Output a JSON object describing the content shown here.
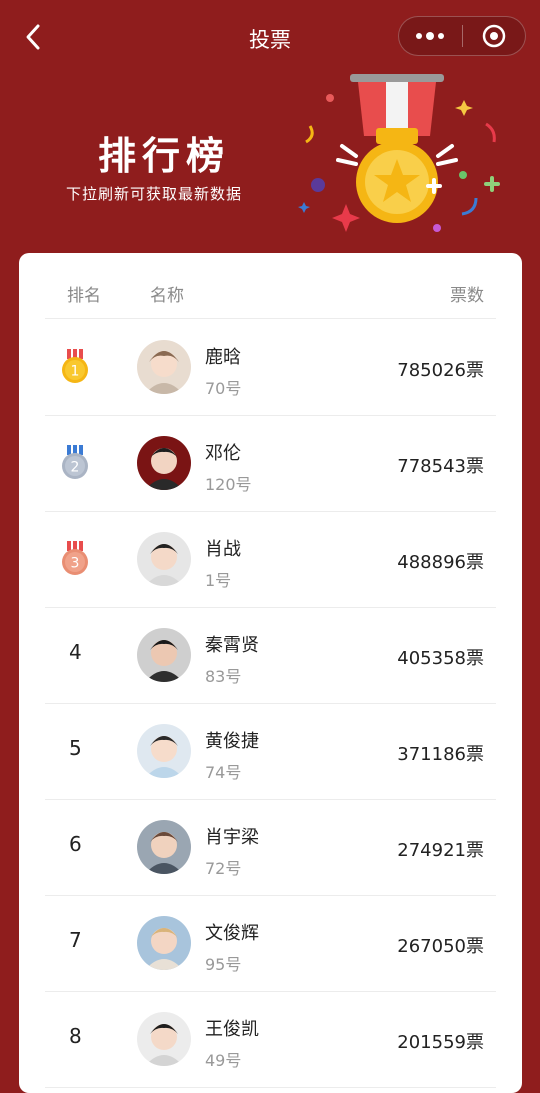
{
  "nav": {
    "title": "投票"
  },
  "banner": {
    "title": "排行榜",
    "subtitle": "下拉刷新可获取最新数据"
  },
  "table": {
    "headers": {
      "rank": "排名",
      "name": "名称",
      "votes": "票数"
    },
    "rows": [
      {
        "rank": "1",
        "name": "鹿晗",
        "number": "70号",
        "votes": "785026票",
        "medal": "gold"
      },
      {
        "rank": "2",
        "name": "邓伦",
        "number": "120号",
        "votes": "778543票",
        "medal": "silver"
      },
      {
        "rank": "3",
        "name": "肖战",
        "number": "1号",
        "votes": "488896票",
        "medal": "bronze"
      },
      {
        "rank": "4",
        "name": "秦霄贤",
        "number": "83号",
        "votes": "405358票"
      },
      {
        "rank": "5",
        "name": "黄俊捷",
        "number": "74号",
        "votes": "371186票"
      },
      {
        "rank": "6",
        "name": "肖宇梁",
        "number": "72号",
        "votes": "274921票"
      },
      {
        "rank": "7",
        "name": "文俊辉",
        "number": "95号",
        "votes": "267050票"
      },
      {
        "rank": "8",
        "name": "王俊凯",
        "number": "49号",
        "votes": "201559票"
      }
    ]
  },
  "colors": {
    "background": "#8f1d1d",
    "gold": "#f5b614",
    "silver": "#aab4c4",
    "bronze": "#e98e73"
  }
}
